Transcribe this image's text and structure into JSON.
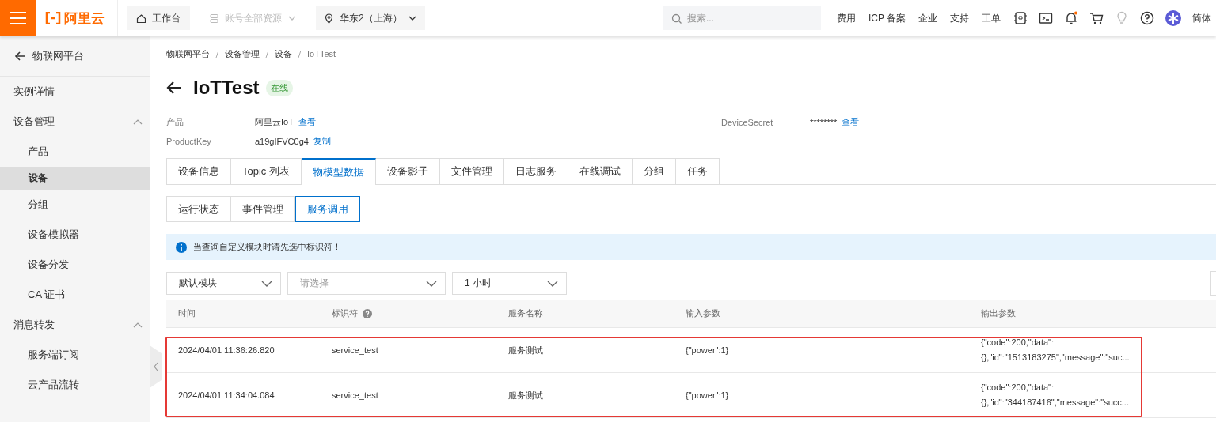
{
  "header": {
    "logo_text": "阿里云",
    "workbench": "工作台",
    "resources": {
      "label": "账号全部资源",
      "disabled": true
    },
    "region": "华东2（上海）",
    "search": {
      "placeholder": "搜索..."
    },
    "links": [
      "费用",
      "ICP 备案",
      "企业",
      "支持",
      "工单"
    ],
    "bell_badge": true,
    "language": "简体"
  },
  "sidebar": {
    "back_label": "物联网平台",
    "items": [
      {
        "label": "实例详情",
        "selected": false
      },
      {
        "label": "设备管理",
        "selected": false,
        "expanded": true,
        "children": [
          {
            "label": "产品",
            "selected": false
          },
          {
            "label": "设备",
            "selected": true
          },
          {
            "label": "分组",
            "selected": false
          },
          {
            "label": "设备模拟器",
            "selected": false
          },
          {
            "label": "设备分发",
            "selected": false
          },
          {
            "label": "CA 证书",
            "selected": false
          }
        ]
      },
      {
        "label": "消息转发",
        "selected": false,
        "expanded": true,
        "children": [
          {
            "label": "服务端订阅",
            "selected": false
          },
          {
            "label": "云产品流转",
            "selected": false
          }
        ]
      }
    ]
  },
  "breadcrumb": [
    "物联网平台",
    "设备管理",
    "设备",
    "IoTTest"
  ],
  "title": "IoTTest",
  "status": "在线",
  "details": [
    {
      "label": "产品",
      "value": "阿里云IoT",
      "action": "查看"
    },
    {
      "label": "DeviceSecret",
      "value": "********",
      "action": "查看"
    },
    {
      "label": "ProductKey",
      "value": "a19gIFVC0g4",
      "action": "复制"
    }
  ],
  "tabs": [
    {
      "label": "设备信息",
      "selected": false
    },
    {
      "label": "Topic 列表",
      "selected": false
    },
    {
      "label": "物模型数据",
      "selected": true
    },
    {
      "label": "设备影子",
      "selected": false
    },
    {
      "label": "文件管理",
      "selected": false
    },
    {
      "label": "日志服务",
      "selected": false
    },
    {
      "label": "在线调试",
      "selected": false
    },
    {
      "label": "分组",
      "selected": false
    },
    {
      "label": "任务",
      "selected": false
    }
  ],
  "subtabs": [
    {
      "label": "运行状态",
      "selected": false
    },
    {
      "label": "事件管理",
      "selected": false
    },
    {
      "label": "服务调用",
      "selected": true
    }
  ],
  "notice": "当查询自定义模块时请先选中标识符！",
  "filters": [
    {
      "value": "默认模块"
    },
    {
      "placeholder": "请选择"
    },
    {
      "value": "1 小时"
    }
  ],
  "table": {
    "columns": [
      {
        "label": "时间",
        "help": false
      },
      {
        "label": "标识符",
        "help": true
      },
      {
        "label": "服务名称",
        "help": false
      },
      {
        "label": "输入参数",
        "help": false
      },
      {
        "label": "输出参数",
        "help": false
      }
    ],
    "rows": [
      {
        "highlighted": true,
        "cells": [
          "2024/04/01 11:36:26.820",
          "service_test",
          "服务测试",
          "{\"power\":1}",
          "{\"code\":200,\"data\":{},\"id\":\"1513183275\",\"message\":\"suc..."
        ]
      },
      {
        "highlighted": true,
        "cells": [
          "2024/04/01 11:34:04.084",
          "service_test",
          "服务测试",
          "{\"power\":1}",
          "{\"code\":200,\"data\":{},\"id\":\"344187416\",\"message\":\"succ..."
        ]
      }
    ]
  }
}
